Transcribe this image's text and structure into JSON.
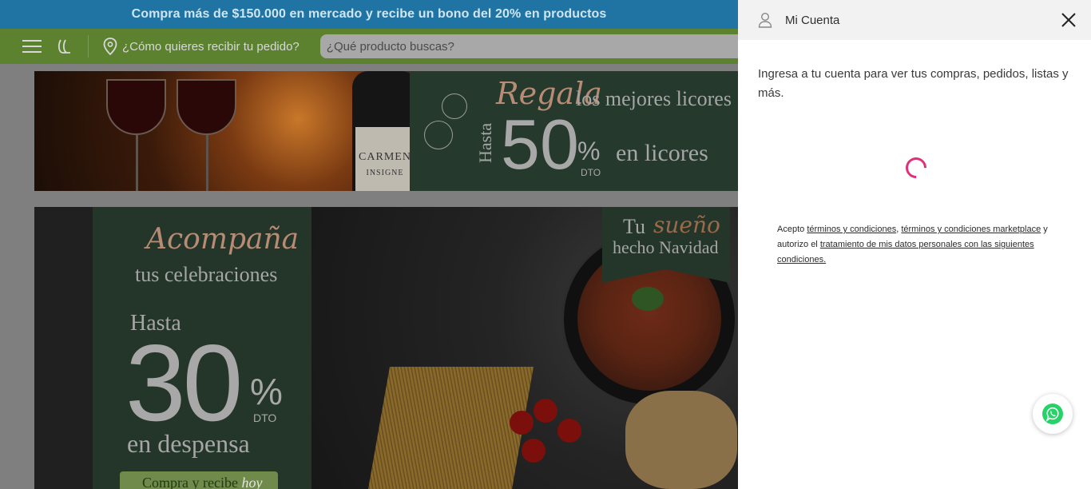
{
  "promo": {
    "text": "Compra más de $150.000 en mercado y recibe un bono del 20% en productos"
  },
  "nav": {
    "menu_icon": "hamburger-icon",
    "logo_icon": "exito-logo-icon",
    "delivery_icon": "location-pin-icon",
    "delivery_label": "¿Cómo quieres recibir tu pedido?",
    "search_placeholder": "¿Qué producto buscas?"
  },
  "banner1": {
    "bottle_label": "CARMEN",
    "bottle_sublabel": "INSIGNE",
    "headline_script": "Regala",
    "headline_rest": "los mejores licores",
    "hasta": "Hasta",
    "discount": "50",
    "percent": "%",
    "dto": "DTO",
    "category": "en licores"
  },
  "banner2": {
    "headline_script": "Acompaña",
    "subheadline": "tus celebraciones",
    "hasta": "Hasta",
    "discount": "30",
    "percent": "%",
    "dto": "DTO",
    "category": "en despensa",
    "cta_label": "Compra y recibe",
    "cta_hoy": "hoy",
    "flag_tu": "Tu",
    "flag_sueno": "sueño",
    "flag_hecho": "hecho Navidad"
  },
  "account": {
    "user_icon": "user-icon",
    "title": "Mi Cuenta",
    "close_icon": "close-icon",
    "intro": "Ingresa a tu cuenta para ver tus compras, pedidos, listas y más.",
    "legal": {
      "acepto": "Acepto",
      "terms": "términos y condiciones",
      "comma": ",",
      "terms_marketplace": "términos y condiciones marketplace",
      "autorizo": "y autorizo el",
      "data_link": "tratamiento de mis datos personales con las siguientes condiciones."
    },
    "whatsapp_icon": "whatsapp-icon"
  },
  "colors": {
    "promo_bg": "#1f74a3",
    "nav_bg": "#5c8230",
    "spinner": "#e0307a",
    "whatsapp": "#25d366"
  }
}
